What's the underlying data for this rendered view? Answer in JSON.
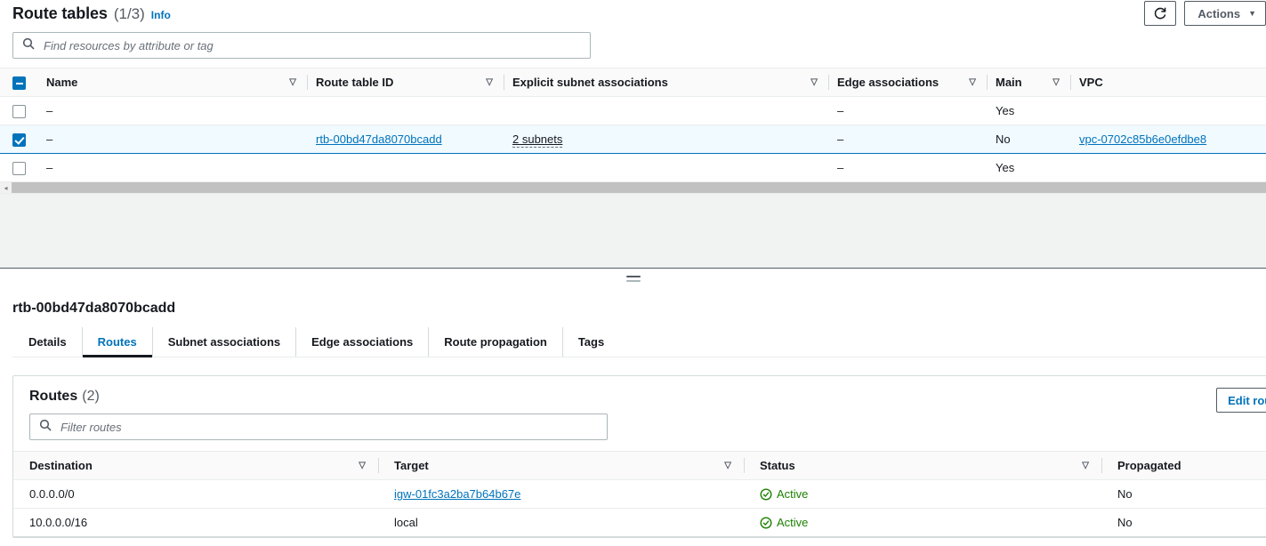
{
  "header": {
    "title": "Route tables",
    "count": "(1/3)",
    "info_label": "Info",
    "refresh_icon": "refresh-icon",
    "actions_label": "Actions",
    "actions_caret": "▼"
  },
  "search": {
    "icon": "search-icon",
    "placeholder": "Find resources by attribute or tag",
    "value": ""
  },
  "route_tables": {
    "columns": [
      {
        "label": "Name",
        "sortable": true
      },
      {
        "label": "Route table ID",
        "sortable": true
      },
      {
        "label": "Explicit subnet associations",
        "sortable": true
      },
      {
        "label": "Edge associations",
        "sortable": true
      },
      {
        "label": "Main",
        "sortable": true
      },
      {
        "label": "VPC",
        "sortable": false
      }
    ],
    "header_checkbox_state": "indeterminate",
    "sort_glyph": "▽",
    "rows": [
      {
        "selected": false,
        "name": "–",
        "route_table_id": "",
        "explicit_subnet_associations": "",
        "edge_associations": "–",
        "main": "Yes",
        "vpc": ""
      },
      {
        "selected": true,
        "name": "–",
        "route_table_id": "rtb-00bd47da8070bcadd",
        "explicit_subnet_associations": "2 subnets",
        "edge_associations": "–",
        "main": "No",
        "vpc": "vpc-0702c85b6e0efdbe8"
      },
      {
        "selected": false,
        "name": "–",
        "route_table_id": "",
        "explicit_subnet_associations": "",
        "edge_associations": "–",
        "main": "Yes",
        "vpc": ""
      }
    ]
  },
  "scrollbar": {
    "left_arrow": "◂"
  },
  "splitter": {
    "handle": "split-panel-drag-handle"
  },
  "detail": {
    "title": "rtb-00bd47da8070bcadd",
    "tabs": [
      {
        "label": "Details",
        "active": false
      },
      {
        "label": "Routes",
        "active": true
      },
      {
        "label": "Subnet associations",
        "active": false
      },
      {
        "label": "Edge associations",
        "active": false
      },
      {
        "label": "Route propagation",
        "active": false
      },
      {
        "label": "Tags",
        "active": false
      }
    ]
  },
  "routes_panel": {
    "title": "Routes",
    "count": "(2)",
    "edit_button_label": "Edit routes",
    "filter": {
      "icon": "search-icon",
      "placeholder": "Filter routes",
      "value": ""
    },
    "columns": [
      {
        "label": "Destination",
        "sortable": true
      },
      {
        "label": "Target",
        "sortable": true
      },
      {
        "label": "Status",
        "sortable": true
      },
      {
        "label": "Propagated",
        "sortable": false
      }
    ],
    "sort_glyph": "▽",
    "rows": [
      {
        "destination": "0.0.0.0/0",
        "target": "igw-01fc3a2ba7b64b67e",
        "target_is_link": true,
        "status": "Active",
        "status_icon": "status-success-icon",
        "propagated": "No"
      },
      {
        "destination": "10.0.0.0/16",
        "target": "local",
        "target_is_link": false,
        "status": "Active",
        "status_icon": "status-success-icon",
        "propagated": "No"
      }
    ]
  },
  "colors": {
    "link": "#0073bb",
    "selected_row_bg": "#f1faff",
    "selected_row_border": "#0073bb",
    "success_green": "#1d8102",
    "header_bg": "#fafafa",
    "empty_pane_bg": "#f1f3f3",
    "border": "#eaeded"
  }
}
